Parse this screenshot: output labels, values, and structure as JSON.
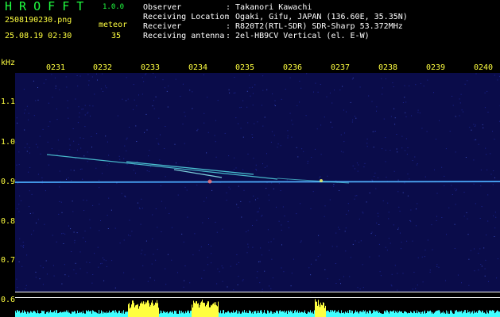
{
  "header": {
    "brand": "H R O F F T",
    "version": "1.0.0",
    "filename": "2508190230.png",
    "datetime": "25.08.19 02:30",
    "meteor_label": "meteor",
    "meteor_count": "35",
    "info_labels": [
      "Observer",
      "Receiving Location",
      "Receiver",
      "Receiving antenna"
    ],
    "info_values": [
      ": Takanori Kawachi",
      ": Ogaki, Gifu, JAPAN (136.60E, 35.35N)",
      ": R820T2(RTL-SDR) SDR-Sharp 53.372MHz",
      ": 2el-HB9CV Vertical (el. E-W)"
    ]
  },
  "axis": {
    "unit": "kHz",
    "time_labels": [
      "0231",
      "0232",
      "0233",
      "0234",
      "0235",
      "0236",
      "0237",
      "0238",
      "0239",
      "0240"
    ],
    "freq_labels": [
      "1.1",
      "1.0",
      "0.9",
      "0.8",
      "0.7",
      "0.6"
    ]
  },
  "colors": {
    "header_text": "#ffffff",
    "brand": "#20ff40",
    "accent_text": "#ffff40",
    "tick_text": "#ffff40",
    "ylabel_text": "#ffff40",
    "spectrum_bg": "#0a0c4a",
    "carrier": "#3aa0ff",
    "meteor_trail": "#60ffff",
    "level_trace": "#40ffff",
    "meteor_peak": "#ffff40"
  }
}
